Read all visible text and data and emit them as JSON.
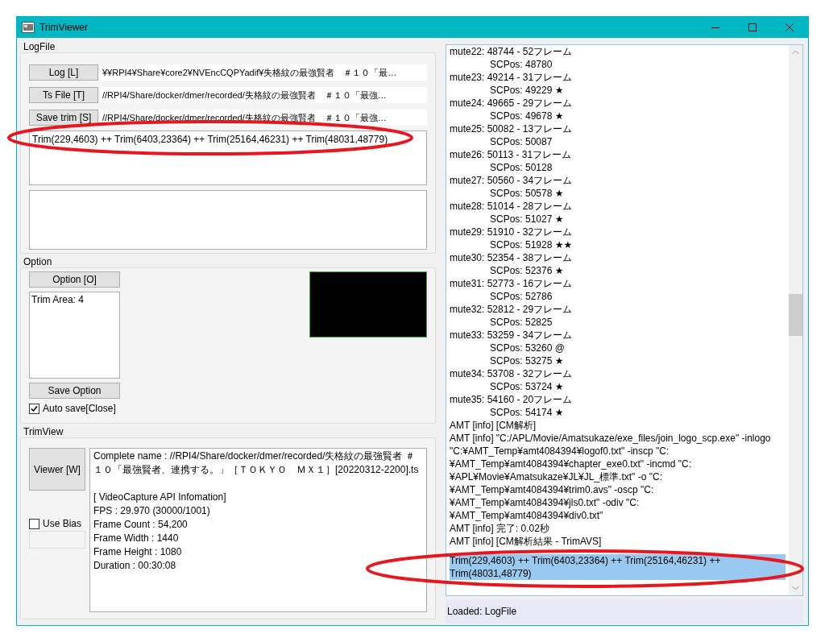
{
  "window": {
    "title": "TrimViewer"
  },
  "logfile": {
    "title": "LogFile",
    "files": [
      {
        "button": "Log [L]",
        "path": "¥¥RPI4¥Share¥core2¥NVEncCQPYadif¥失格紋の最強賢者　＃１０「最…"
      },
      {
        "button": "Ts File [T]",
        "path": "//RPI4/Share/docker/dmer/recorded/失格紋の最強賢者　＃１０「最強…"
      },
      {
        "button": "Save trim [S]",
        "path": "//RPI4/Share/docker/dmer/recorded/失格紋の最強賢者　＃１０「最強…"
      }
    ],
    "trim_text": "Trim(229,4603) ++ Trim(6403,23364) ++ Trim(25164,46231) ++ Trim(48031,48779)"
  },
  "option": {
    "title": "Option",
    "button": "Option [O]",
    "list": [
      "Trim Area: 4"
    ],
    "save_button": "Save Option",
    "auto_save": {
      "label": "Auto save[Close]",
      "checked": true
    }
  },
  "trimview": {
    "title": "TrimView",
    "viewer_button": "Viewer [W]",
    "use_bias": {
      "label": "Use Bias",
      "checked": false
    },
    "file_line": "Complete name : //RPI4/Share/docker/dmer/recorded/失格紋の最強賢者 ＃１０「最強賢者、連携する。」［ＴＯＫＹＯ　ＭＸ１］[20220312-2200].ts",
    "section_title": "[ VideoCapture API Infomation]",
    "lines": [
      "FPS : 29.970 (30000/1001)",
      "Frame Count : 54,200",
      "Frame Width : 1440",
      "Frame Height : 1080",
      "Duration : 00:30:08"
    ]
  },
  "log": {
    "lines": [
      {
        "kind": "line",
        "text": "mute22: 48744 - 52フレーム"
      },
      {
        "kind": "sub",
        "text": "SCPos: 48780"
      },
      {
        "kind": "line",
        "text": "mute23: 49214 - 31フレーム"
      },
      {
        "kind": "sub",
        "text": "SCPos: 49229 ★"
      },
      {
        "kind": "line",
        "text": "mute24: 49665 - 29フレーム"
      },
      {
        "kind": "sub",
        "text": "SCPos: 49678 ★"
      },
      {
        "kind": "line",
        "text": "mute25: 50082 - 13フレーム"
      },
      {
        "kind": "sub",
        "text": "SCPos: 50087"
      },
      {
        "kind": "line",
        "text": "mute26: 50113 - 31フレーム"
      },
      {
        "kind": "sub",
        "text": "SCPos: 50128"
      },
      {
        "kind": "line",
        "text": "mute27: 50560 - 34フレーム"
      },
      {
        "kind": "sub",
        "text": "SCPos: 50578 ★"
      },
      {
        "kind": "line",
        "text": "mute28: 51014 - 28フレーム"
      },
      {
        "kind": "sub",
        "text": "SCPos: 51027 ★"
      },
      {
        "kind": "line",
        "text": "mute29: 51910 - 32フレーム"
      },
      {
        "kind": "sub",
        "text": "SCPos: 51928 ★★"
      },
      {
        "kind": "line",
        "text": "mute30: 52354 - 38フレーム"
      },
      {
        "kind": "sub",
        "text": "SCPos: 52376 ★"
      },
      {
        "kind": "line",
        "text": "mute31: 52773 - 16フレーム"
      },
      {
        "kind": "sub",
        "text": "SCPos: 52786"
      },
      {
        "kind": "line",
        "text": "mute32: 52812 - 29フレーム"
      },
      {
        "kind": "sub",
        "text": "SCPos: 52825"
      },
      {
        "kind": "line",
        "text": "mute33: 53259 - 34フレーム"
      },
      {
        "kind": "sub",
        "text": "SCPos: 53260 @"
      },
      {
        "kind": "sub",
        "text": "SCPos: 53275 ★"
      },
      {
        "kind": "line",
        "text": "mute34: 53708 - 32フレーム"
      },
      {
        "kind": "sub",
        "text": "SCPos: 53724 ★"
      },
      {
        "kind": "line",
        "text": "mute35: 54160 - 20フレーム"
      },
      {
        "kind": "sub",
        "text": "SCPos: 54174 ★"
      },
      {
        "kind": "line",
        "text": "AMT [info] [CM解析]"
      },
      {
        "kind": "line",
        "text": "AMT [info] \"C:/APL/Movie/Amatsukaze/exe_files/join_logo_scp.exe\" -inlogo \"C:¥AMT_Temp¥amt4084394¥logof0.txt\" -inscp \"C:¥AMT_Temp¥amt4084394¥chapter_exe0.txt\" -incmd \"C:¥APL¥Movie¥Amatsukaze¥JL¥JL_標準.txt\" -o \"C:¥AMT_Temp¥amt4084394¥trim0.avs\" -oscp \"C:¥AMT_Temp¥amt4084394¥jls0.txt\" -odiv \"C:¥AMT_Temp¥amt4084394¥div0.txt\""
      },
      {
        "kind": "line",
        "text": "AMT [info] 完了: 0.02秒"
      },
      {
        "kind": "line",
        "text": "AMT [info] [CM解析結果 - TrimAVS]"
      },
      {
        "kind": "selected",
        "text": "Trim(229,4603) ++ Trim(6403,23364) ++ Trim(25164,46231) ++ Trim(48031,48779)"
      }
    ]
  },
  "status_bar": "Loaded: LogFile"
}
